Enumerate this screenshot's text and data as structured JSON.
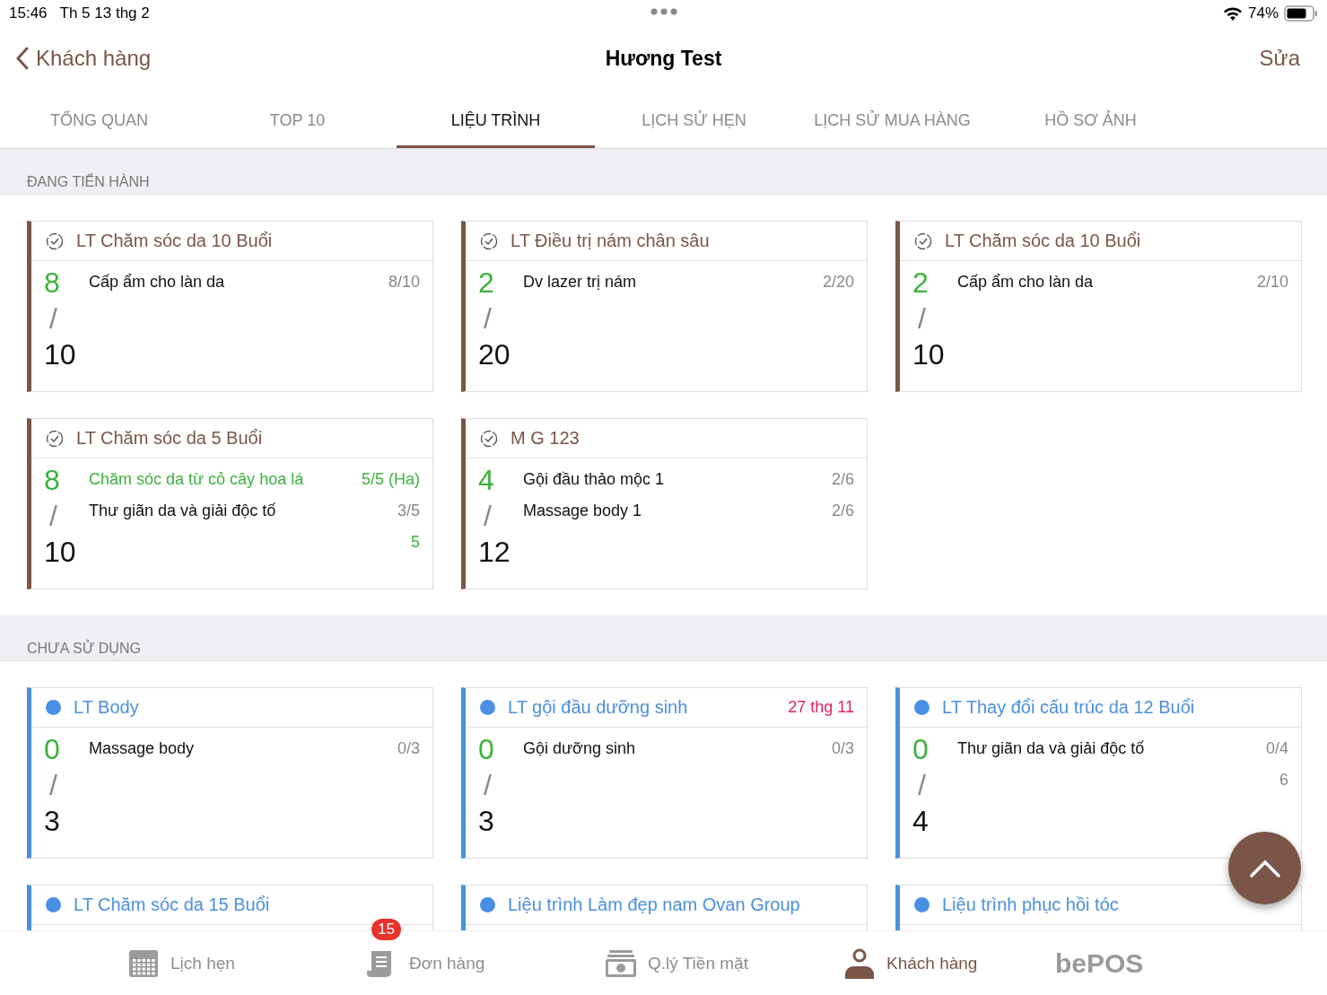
{
  "status_bar": {
    "time": "15:46",
    "date": "Th 5 13 thg 2",
    "battery": "74%"
  },
  "nav": {
    "back": "Khách hàng",
    "title": "Hương Test",
    "action": "Sửa"
  },
  "tabs": [
    {
      "label": "TỔNG QUAN",
      "selected": false
    },
    {
      "label": "TOP 10",
      "selected": false
    },
    {
      "label": "LIỆU TRÌNH",
      "selected": true
    },
    {
      "label": "LỊCH SỬ HẸN",
      "selected": false
    },
    {
      "label": "LỊCH SỬ MUA HÀNG",
      "selected": false
    },
    {
      "label": "HỒ SƠ ẢNH",
      "selected": false
    }
  ],
  "sections": [
    {
      "title": "ĐANG TIẾN HÀNH",
      "kind": "in_progress",
      "cards": [
        {
          "title": "LT Chăm sóc da 10  Buổi",
          "used": "8",
          "separator": "/",
          "total": "10",
          "services": [
            {
              "name": "Cấp ẩm cho làn da",
              "count": "8/10",
              "done": false
            }
          ]
        },
        {
          "title": "LT Điều trị nám chân sâu",
          "used": "2",
          "separator": "/",
          "total": "20",
          "services": [
            {
              "name": "Dv lazer trị nám",
              "count": "2/20",
              "done": false
            }
          ]
        },
        {
          "title": "LT Chăm sóc da 10  Buổi",
          "used": "2",
          "separator": "/",
          "total": "10",
          "services": [
            {
              "name": "Cấp ẩm cho làn da",
              "count": "2/10",
              "done": false
            }
          ]
        },
        {
          "title": "LT Chăm sóc da 5 Buổi",
          "used": "8",
          "separator": "/",
          "total": "10",
          "services": [
            {
              "name": "Chăm sóc da từ cỏ cây hoa lá",
              "count": "5/5 (Ha)",
              "done": true
            },
            {
              "name": "Thư giãn da và giải độc tố",
              "count": "3/5",
              "done": false
            }
          ],
          "extra": {
            "text": "5",
            "done": true
          }
        },
        {
          "title": "M G 123",
          "used": "4",
          "separator": "/",
          "total": "12",
          "services": [
            {
              "name": "Gội đầu thảo mộc 1",
              "count": "2/6",
              "done": false
            },
            {
              "name": "Massage body 1",
              "count": "2/6",
              "done": false
            }
          ]
        }
      ]
    },
    {
      "title": "CHƯA SỬ DỤNG",
      "kind": "unused",
      "cards": [
        {
          "title": "LT Body",
          "used": "0",
          "separator": "/",
          "total": "3",
          "services": [
            {
              "name": "Massage body",
              "count": "0/3",
              "done": false
            }
          ]
        },
        {
          "title": "LT gội đầu dưỡng sinh",
          "date": "27 thg 11",
          "used": "0",
          "separator": "/",
          "total": "3",
          "services": [
            {
              "name": "Gội dưỡng sinh",
              "count": "0/3",
              "done": false
            }
          ]
        },
        {
          "title": "LT Thay đổi cấu trúc da 12 Buổi",
          "used": "0",
          "separator": "/",
          "total": "4",
          "services": [
            {
              "name": "Thư giãn da và giải độc tố",
              "count": "0/4",
              "done": false
            }
          ],
          "extra": {
            "text": "6",
            "done": false
          }
        },
        {
          "title": "LT Chăm sóc da 15 Buổi"
        },
        {
          "title": "Liệu trình Làm đẹp nam Ovan Group"
        },
        {
          "title": "Liệu trình phục hồi tóc"
        }
      ]
    }
  ],
  "bottom_tabs": [
    {
      "label": "Lịch hẹn",
      "kind": "calendar",
      "selected": false
    },
    {
      "label": "Đơn hàng",
      "kind": "orders",
      "selected": false,
      "badge": "15"
    },
    {
      "label": "Q.lý Tiền mặt",
      "kind": "cash",
      "selected": false
    },
    {
      "label": "Khách hàng",
      "kind": "customers",
      "selected": true
    }
  ],
  "logo": "bePOS"
}
